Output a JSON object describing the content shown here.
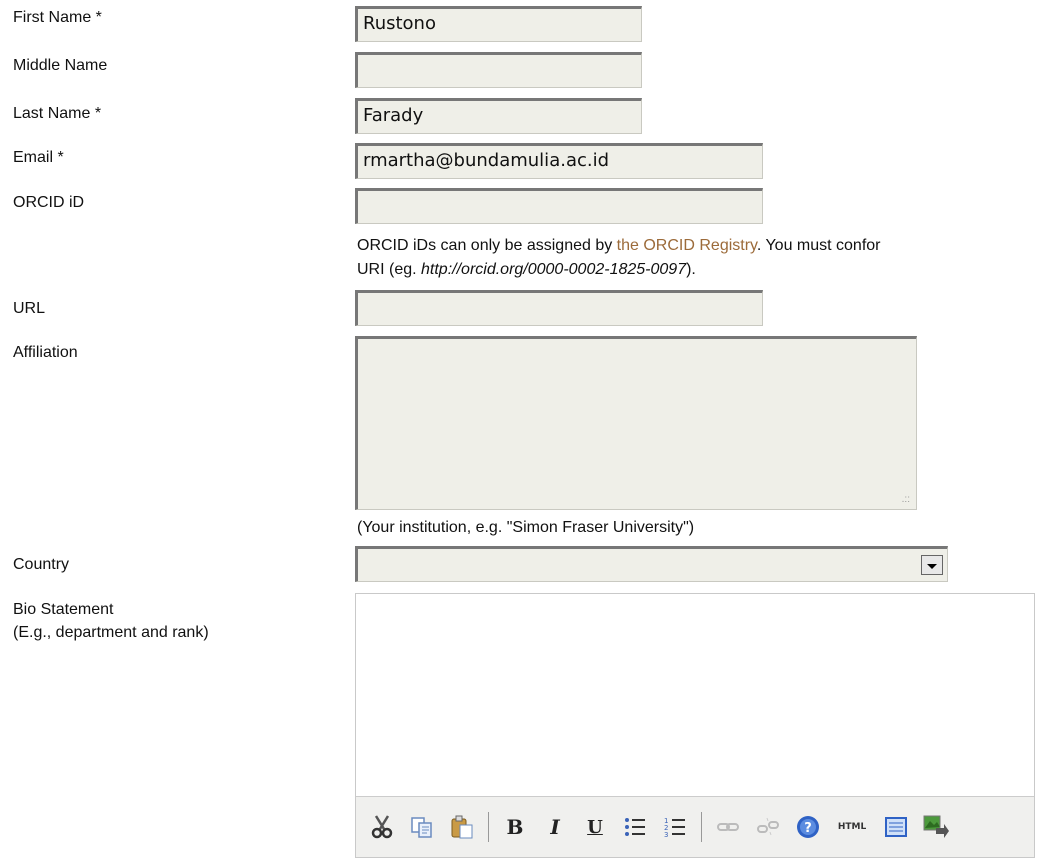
{
  "form": {
    "first_name": {
      "label": "First Name *",
      "value": "Rustono"
    },
    "middle_name": {
      "label": "Middle Name",
      "value": ""
    },
    "last_name": {
      "label": "Last Name *",
      "value": "Farady"
    },
    "email": {
      "label": "Email *",
      "value": "rmartha@bundamulia.ac.id"
    },
    "orcid": {
      "label": "ORCID iD",
      "value": "",
      "note_part1": "ORCID iDs can only be assigned by ",
      "note_link": "the ORCID Registry",
      "note_part2": ". You must confor",
      "note_line2_part1": "URI (eg. ",
      "note_line2_example": "http://orcid.org/0000-0002-1825-0097",
      "note_line2_part2": ")."
    },
    "url": {
      "label": "URL",
      "value": ""
    },
    "affiliation": {
      "label": "Affiliation",
      "value": "",
      "hint": "(Your institution, e.g. \"Simon Fraser University\")"
    },
    "country": {
      "label": "Country",
      "selected": ""
    },
    "bio": {
      "label": "Bio Statement",
      "sublabel": "(E.g., department and rank)",
      "value": ""
    }
  },
  "toolbar": {
    "bold_glyph": "B",
    "italic_glyph": "I",
    "underline_glyph": "U",
    "html_label": "HTML"
  },
  "colors": {
    "link": "#9c6b3a",
    "field_bg": "#efefe8"
  }
}
